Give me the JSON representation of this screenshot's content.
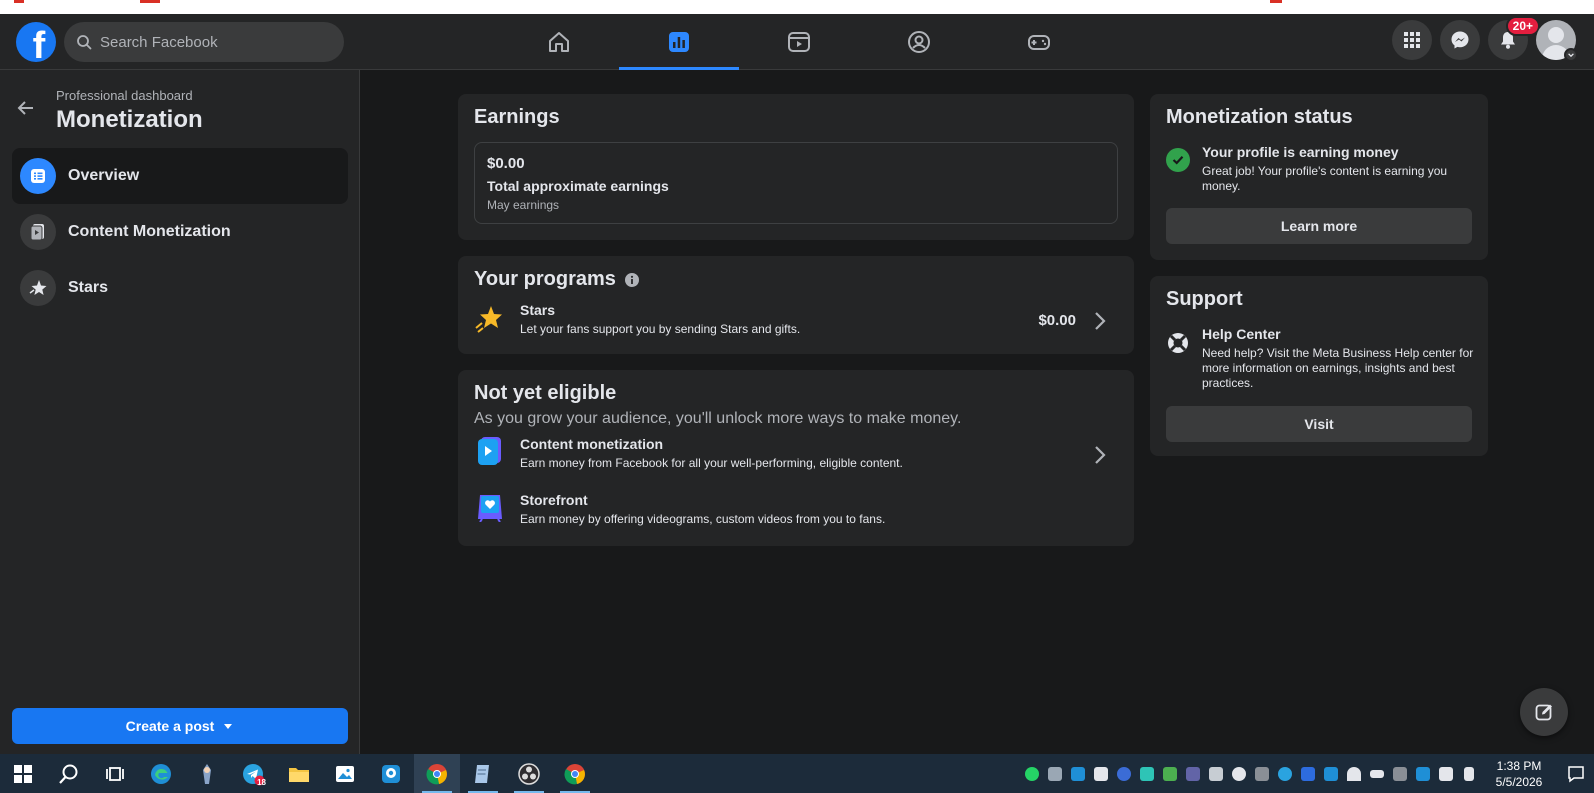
{
  "search": {
    "placeholder": "Search Facebook"
  },
  "top_nav": {
    "tabs": [
      "home-icon",
      "dashboard-icon",
      "video-icon",
      "groups-icon",
      "gaming-icon"
    ],
    "notification_badge": "20+"
  },
  "sidebar": {
    "subtitle": "Professional dashboard",
    "title": "Monetization",
    "items": [
      {
        "label": "Overview",
        "icon": "list-icon",
        "active": true
      },
      {
        "label": "Content Monetization",
        "icon": "content-monetization-icon",
        "active": false
      },
      {
        "label": "Stars",
        "icon": "star-icon",
        "active": false
      }
    ],
    "create_post_label": "Create a post"
  },
  "earnings": {
    "title": "Earnings",
    "amount": "$0.00",
    "label": "Total approximate earnings",
    "period": "May earnings"
  },
  "programs": {
    "title": "Your programs",
    "items": [
      {
        "title": "Stars",
        "description": "Let your fans support you by sending Stars and gifts.",
        "amount": "$0.00"
      }
    ]
  },
  "not_eligible": {
    "title": "Not yet eligible",
    "subtitle": "As you grow your audience, you'll unlock more ways to make money.",
    "items": [
      {
        "title": "Content monetization",
        "description": "Earn money from Facebook for all your well-performing, eligible content."
      },
      {
        "title": "Storefront",
        "description": "Earn money by offering videograms, custom videos from you to fans."
      }
    ]
  },
  "monetization_status": {
    "title": "Monetization status",
    "heading": "Your profile is earning money",
    "description": "Great job! Your profile's content is earning you money.",
    "button_label": "Learn more"
  },
  "support": {
    "title": "Support",
    "heading": "Help Center",
    "description": "Need help? Visit the Meta Business Help center for more information on earnings, insights and best practices.",
    "button_label": "Visit"
  },
  "taskbar": {
    "telegram_badge": "18",
    "time": "1:38 PM",
    "date": "5/5/2026"
  },
  "colors": {
    "accent": "#1877f2",
    "active_tab": "#2d88ff",
    "success": "#31a24c",
    "badge": "#e41e3f"
  }
}
